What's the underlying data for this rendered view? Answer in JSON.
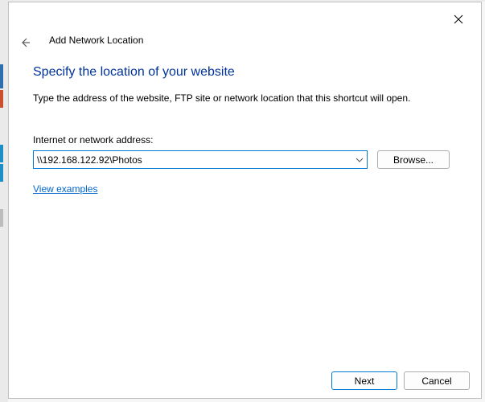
{
  "window": {
    "title": "Add Network Location"
  },
  "page": {
    "heading": "Specify the location of your website",
    "description": "Type the address of the website, FTP site or network location that this shortcut will open.",
    "address_label": "Internet or network address:",
    "address_value": "\\\\192.168.122.92\\Photos",
    "browse_label": "Browse...",
    "examples_link": "View examples"
  },
  "footer": {
    "next": "Next",
    "cancel": "Cancel"
  }
}
